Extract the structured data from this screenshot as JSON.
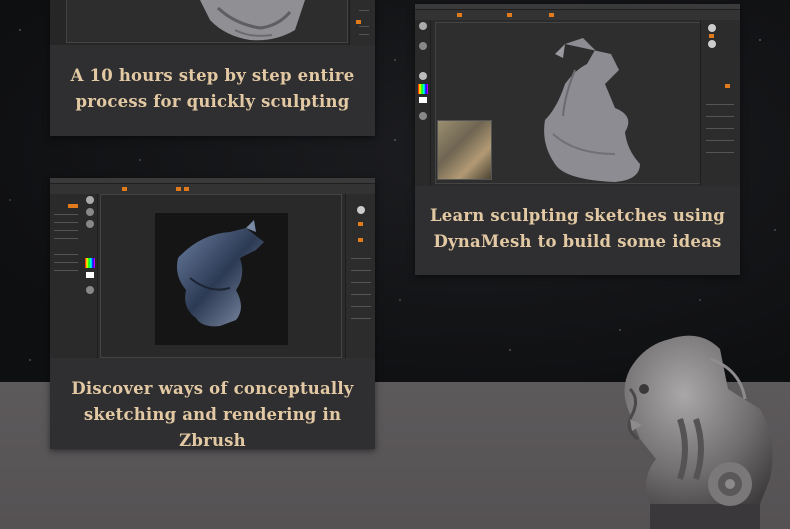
{
  "cards": [
    {
      "caption_lines": [
        "A 10 hours step by step entire",
        "process for quickly sculpting"
      ]
    },
    {
      "caption_lines": [
        "Learn sculpting sketches using",
        "DynaMesh to build some ideas"
      ]
    },
    {
      "caption_lines": [
        "Discover ways of conceptually",
        "sketching and rendering in Zbrush"
      ]
    }
  ],
  "colors": {
    "caption": "#e3c9a3",
    "card": "#2f2f31",
    "accent": "#e07a1c",
    "floor": "#5d5a5c"
  }
}
